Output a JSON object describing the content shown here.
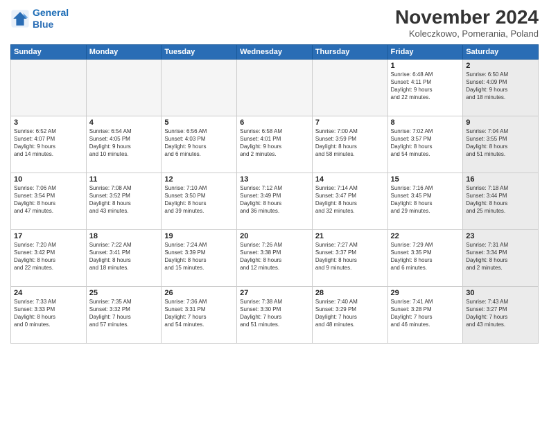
{
  "header": {
    "logo_line1": "General",
    "logo_line2": "Blue",
    "month": "November 2024",
    "location": "Koleczkowo, Pomerania, Poland"
  },
  "weekdays": [
    "Sunday",
    "Monday",
    "Tuesday",
    "Wednesday",
    "Thursday",
    "Friday",
    "Saturday"
  ],
  "weeks": [
    [
      {
        "day": "",
        "info": "",
        "shaded": false,
        "empty": true
      },
      {
        "day": "",
        "info": "",
        "shaded": false,
        "empty": true
      },
      {
        "day": "",
        "info": "",
        "shaded": false,
        "empty": true
      },
      {
        "day": "",
        "info": "",
        "shaded": false,
        "empty": true
      },
      {
        "day": "",
        "info": "",
        "shaded": false,
        "empty": true
      },
      {
        "day": "1",
        "info": "Sunrise: 6:48 AM\nSunset: 4:11 PM\nDaylight: 9 hours\nand 22 minutes.",
        "shaded": false,
        "empty": false
      },
      {
        "day": "2",
        "info": "Sunrise: 6:50 AM\nSunset: 4:09 PM\nDaylight: 9 hours\nand 18 minutes.",
        "shaded": true,
        "empty": false
      }
    ],
    [
      {
        "day": "3",
        "info": "Sunrise: 6:52 AM\nSunset: 4:07 PM\nDaylight: 9 hours\nand 14 minutes.",
        "shaded": false,
        "empty": false
      },
      {
        "day": "4",
        "info": "Sunrise: 6:54 AM\nSunset: 4:05 PM\nDaylight: 9 hours\nand 10 minutes.",
        "shaded": false,
        "empty": false
      },
      {
        "day": "5",
        "info": "Sunrise: 6:56 AM\nSunset: 4:03 PM\nDaylight: 9 hours\nand 6 minutes.",
        "shaded": false,
        "empty": false
      },
      {
        "day": "6",
        "info": "Sunrise: 6:58 AM\nSunset: 4:01 PM\nDaylight: 9 hours\nand 2 minutes.",
        "shaded": false,
        "empty": false
      },
      {
        "day": "7",
        "info": "Sunrise: 7:00 AM\nSunset: 3:59 PM\nDaylight: 8 hours\nand 58 minutes.",
        "shaded": false,
        "empty": false
      },
      {
        "day": "8",
        "info": "Sunrise: 7:02 AM\nSunset: 3:57 PM\nDaylight: 8 hours\nand 54 minutes.",
        "shaded": false,
        "empty": false
      },
      {
        "day": "9",
        "info": "Sunrise: 7:04 AM\nSunset: 3:55 PM\nDaylight: 8 hours\nand 51 minutes.",
        "shaded": true,
        "empty": false
      }
    ],
    [
      {
        "day": "10",
        "info": "Sunrise: 7:06 AM\nSunset: 3:54 PM\nDaylight: 8 hours\nand 47 minutes.",
        "shaded": false,
        "empty": false
      },
      {
        "day": "11",
        "info": "Sunrise: 7:08 AM\nSunset: 3:52 PM\nDaylight: 8 hours\nand 43 minutes.",
        "shaded": false,
        "empty": false
      },
      {
        "day": "12",
        "info": "Sunrise: 7:10 AM\nSunset: 3:50 PM\nDaylight: 8 hours\nand 39 minutes.",
        "shaded": false,
        "empty": false
      },
      {
        "day": "13",
        "info": "Sunrise: 7:12 AM\nSunset: 3:49 PM\nDaylight: 8 hours\nand 36 minutes.",
        "shaded": false,
        "empty": false
      },
      {
        "day": "14",
        "info": "Sunrise: 7:14 AM\nSunset: 3:47 PM\nDaylight: 8 hours\nand 32 minutes.",
        "shaded": false,
        "empty": false
      },
      {
        "day": "15",
        "info": "Sunrise: 7:16 AM\nSunset: 3:45 PM\nDaylight: 8 hours\nand 29 minutes.",
        "shaded": false,
        "empty": false
      },
      {
        "day": "16",
        "info": "Sunrise: 7:18 AM\nSunset: 3:44 PM\nDaylight: 8 hours\nand 25 minutes.",
        "shaded": true,
        "empty": false
      }
    ],
    [
      {
        "day": "17",
        "info": "Sunrise: 7:20 AM\nSunset: 3:42 PM\nDaylight: 8 hours\nand 22 minutes.",
        "shaded": false,
        "empty": false
      },
      {
        "day": "18",
        "info": "Sunrise: 7:22 AM\nSunset: 3:41 PM\nDaylight: 8 hours\nand 18 minutes.",
        "shaded": false,
        "empty": false
      },
      {
        "day": "19",
        "info": "Sunrise: 7:24 AM\nSunset: 3:39 PM\nDaylight: 8 hours\nand 15 minutes.",
        "shaded": false,
        "empty": false
      },
      {
        "day": "20",
        "info": "Sunrise: 7:26 AM\nSunset: 3:38 PM\nDaylight: 8 hours\nand 12 minutes.",
        "shaded": false,
        "empty": false
      },
      {
        "day": "21",
        "info": "Sunrise: 7:27 AM\nSunset: 3:37 PM\nDaylight: 8 hours\nand 9 minutes.",
        "shaded": false,
        "empty": false
      },
      {
        "day": "22",
        "info": "Sunrise: 7:29 AM\nSunset: 3:35 PM\nDaylight: 8 hours\nand 6 minutes.",
        "shaded": false,
        "empty": false
      },
      {
        "day": "23",
        "info": "Sunrise: 7:31 AM\nSunset: 3:34 PM\nDaylight: 8 hours\nand 2 minutes.",
        "shaded": true,
        "empty": false
      }
    ],
    [
      {
        "day": "24",
        "info": "Sunrise: 7:33 AM\nSunset: 3:33 PM\nDaylight: 8 hours\nand 0 minutes.",
        "shaded": false,
        "empty": false
      },
      {
        "day": "25",
        "info": "Sunrise: 7:35 AM\nSunset: 3:32 PM\nDaylight: 7 hours\nand 57 minutes.",
        "shaded": false,
        "empty": false
      },
      {
        "day": "26",
        "info": "Sunrise: 7:36 AM\nSunset: 3:31 PM\nDaylight: 7 hours\nand 54 minutes.",
        "shaded": false,
        "empty": false
      },
      {
        "day": "27",
        "info": "Sunrise: 7:38 AM\nSunset: 3:30 PM\nDaylight: 7 hours\nand 51 minutes.",
        "shaded": false,
        "empty": false
      },
      {
        "day": "28",
        "info": "Sunrise: 7:40 AM\nSunset: 3:29 PM\nDaylight: 7 hours\nand 48 minutes.",
        "shaded": false,
        "empty": false
      },
      {
        "day": "29",
        "info": "Sunrise: 7:41 AM\nSunset: 3:28 PM\nDaylight: 7 hours\nand 46 minutes.",
        "shaded": false,
        "empty": false
      },
      {
        "day": "30",
        "info": "Sunrise: 7:43 AM\nSunset: 3:27 PM\nDaylight: 7 hours\nand 43 minutes.",
        "shaded": true,
        "empty": false
      }
    ]
  ]
}
